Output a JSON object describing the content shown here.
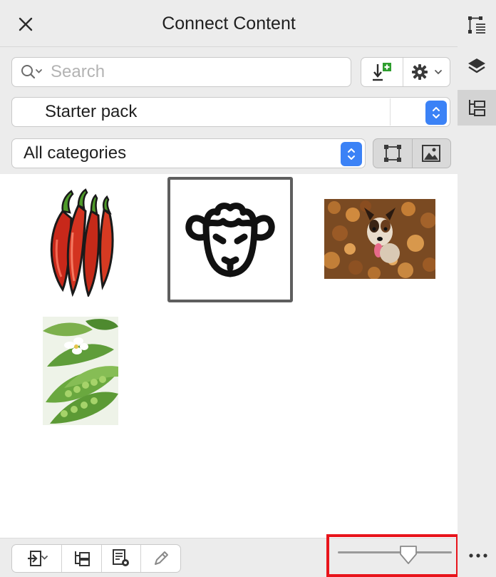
{
  "panel": {
    "title": "Connect Content"
  },
  "search": {
    "placeholder": "Search"
  },
  "library_select": {
    "value": "Starter pack"
  },
  "category_select": {
    "value": "All categories"
  },
  "content": {
    "items": [
      {
        "icon": "chili-peppers-image",
        "selected": false
      },
      {
        "icon": "sheep-face-image",
        "selected": true
      },
      {
        "icon": "dog-in-leaves-photo",
        "selected": false
      },
      {
        "icon": "green-peas-photo",
        "selected": false
      }
    ]
  },
  "footer": {
    "thumbnail_size": 0.62
  },
  "colors": {
    "accent": "#3b82f6",
    "highlight": "#e8141b",
    "chrome": "#ececec"
  }
}
